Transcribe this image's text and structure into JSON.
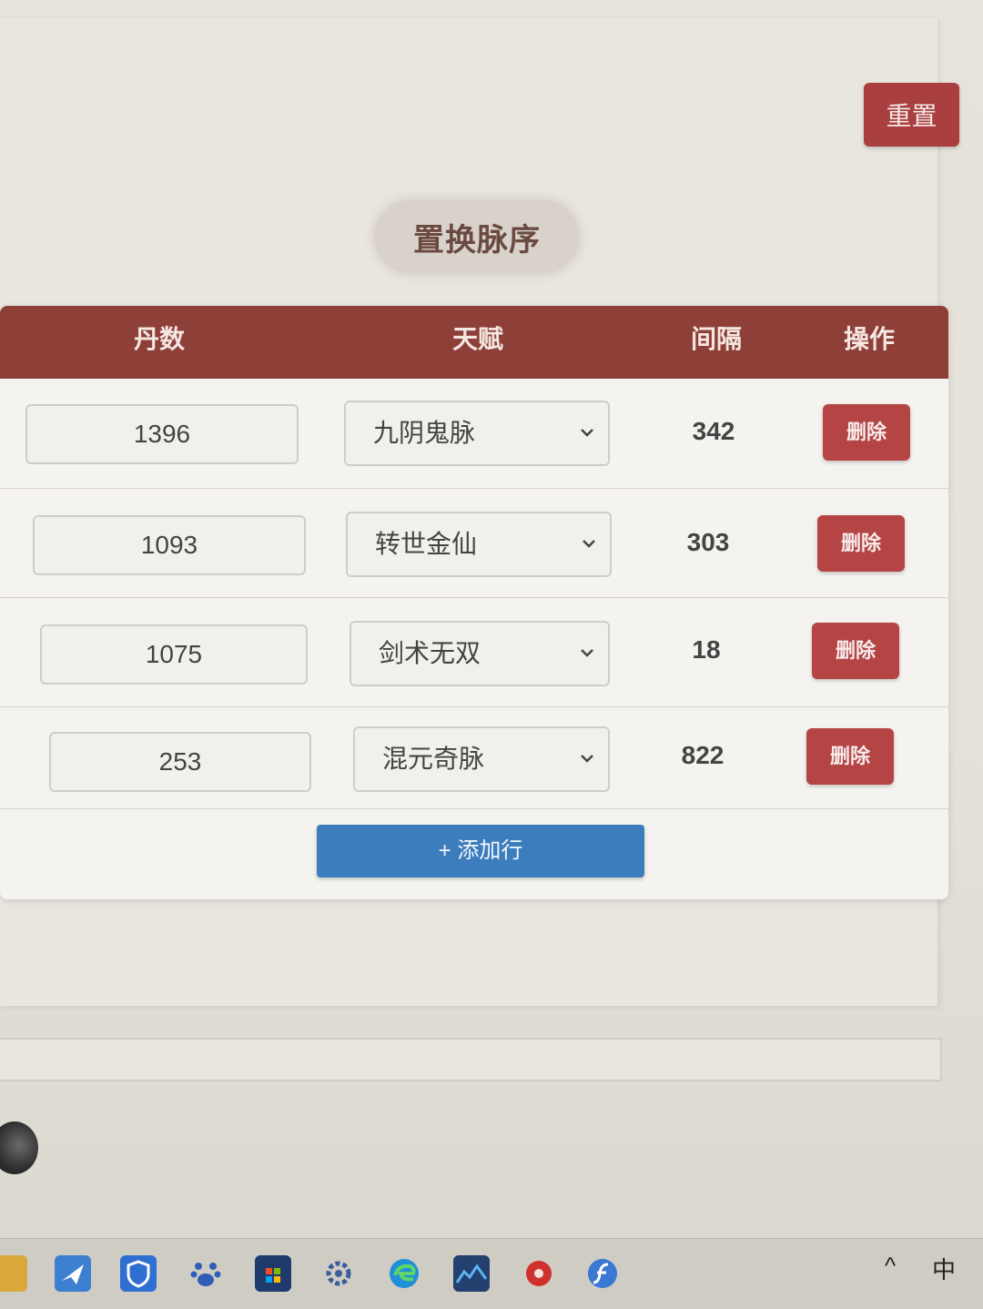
{
  "header": {
    "reset_label": "重置"
  },
  "page_title": "置换脉序",
  "table": {
    "columns": [
      "丹数",
      "天赋",
      "间隔",
      "操作"
    ],
    "rows": [
      {
        "count": "1396",
        "talent": "九阴鬼脉",
        "interval": "342",
        "action": "删除"
      },
      {
        "count": "1093",
        "talent": "转世金仙",
        "interval": "303",
        "action": "删除"
      },
      {
        "count": "1075",
        "talent": "剑术无双",
        "interval": "18",
        "action": "删除"
      },
      {
        "count": "253",
        "talent": "混元奇脉",
        "interval": "822",
        "action": "删除"
      }
    ],
    "add_row_label": "+ 添加行"
  },
  "taskbar": {
    "icons": [
      "folder-icon",
      "mail-icon",
      "shield-icon",
      "paw-icon",
      "store-icon",
      "gear-icon",
      "edge-icon",
      "photo-icon",
      "music-icon",
      "flash-icon"
    ],
    "chevron": "^",
    "ime": "中"
  }
}
